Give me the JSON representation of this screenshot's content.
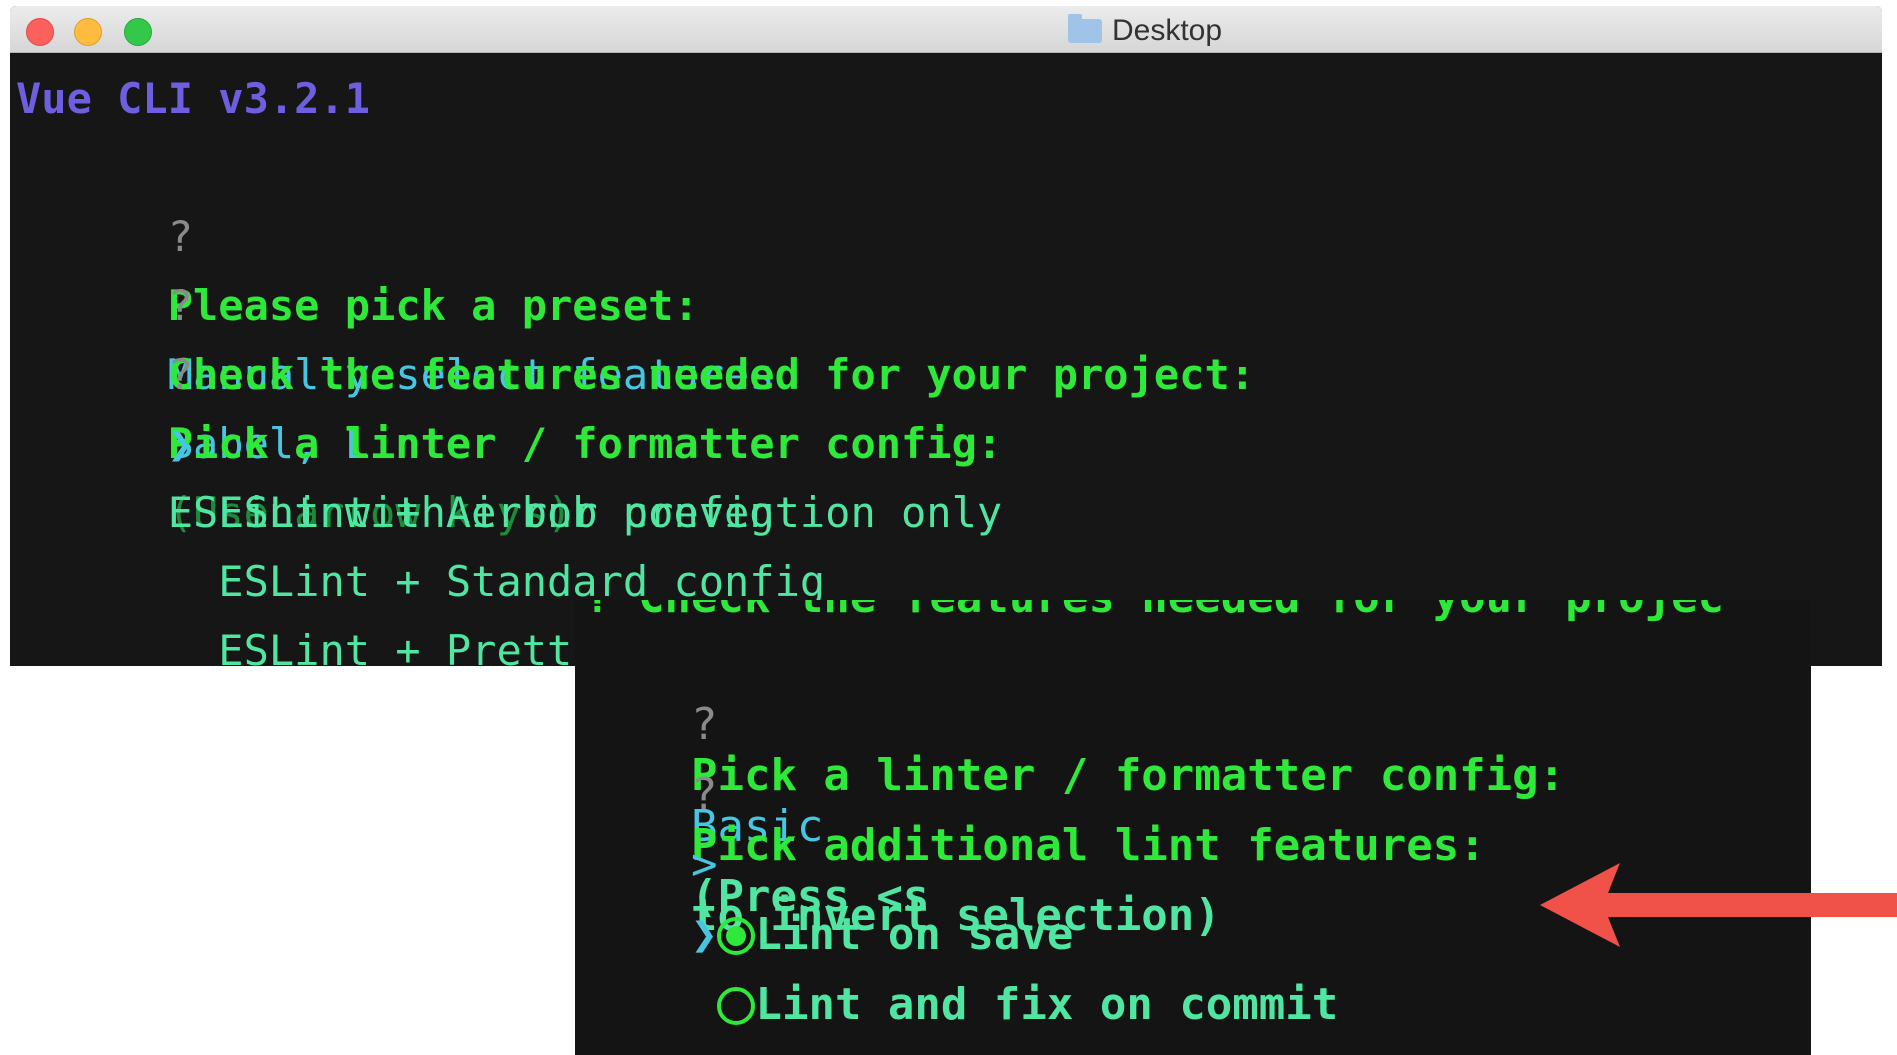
{
  "window": {
    "title": "Desktop",
    "icon": "folder-icon"
  },
  "terminal1": {
    "header": "Vue CLI v3.2.1",
    "q1": {
      "mark": "?",
      "prompt": "Please pick a preset:",
      "answer": "Manually select features"
    },
    "q2": {
      "mark": "?",
      "prompt": "Check the features needed for your project:",
      "answer": "Babel, Linter"
    },
    "q3": {
      "mark": "?",
      "prompt": "Pick a linter / formatter config:",
      "hint": "(Use arrow keys)"
    },
    "pointer": "❯",
    "options": [
      "ESLint with error prevention only",
      "ESLint + Airbnb config",
      "ESLint + Standard config",
      "ESLint + Prettier"
    ]
  },
  "terminal2": {
    "clipped": "? Check the features needed for your projec",
    "q1": {
      "mark": "?",
      "prompt": "Pick a linter / formatter config:",
      "answer": "Basic"
    },
    "q2": {
      "mark": "?",
      "prompt": "Pick additional lint features:",
      "hint": "(Press <s"
    },
    "q2_cont": {
      "mark": ">",
      "text": "to invert selection)"
    },
    "pointer": "❯",
    "options": [
      {
        "label": "Lint on save",
        "checked": true
      },
      {
        "label": "Lint and fix on commit",
        "checked": false
      }
    ]
  },
  "colors": {
    "accent_arrow": "#f0524a",
    "prompt_green": "#2ee83a",
    "answer_cyan": "#47c6e2"
  }
}
